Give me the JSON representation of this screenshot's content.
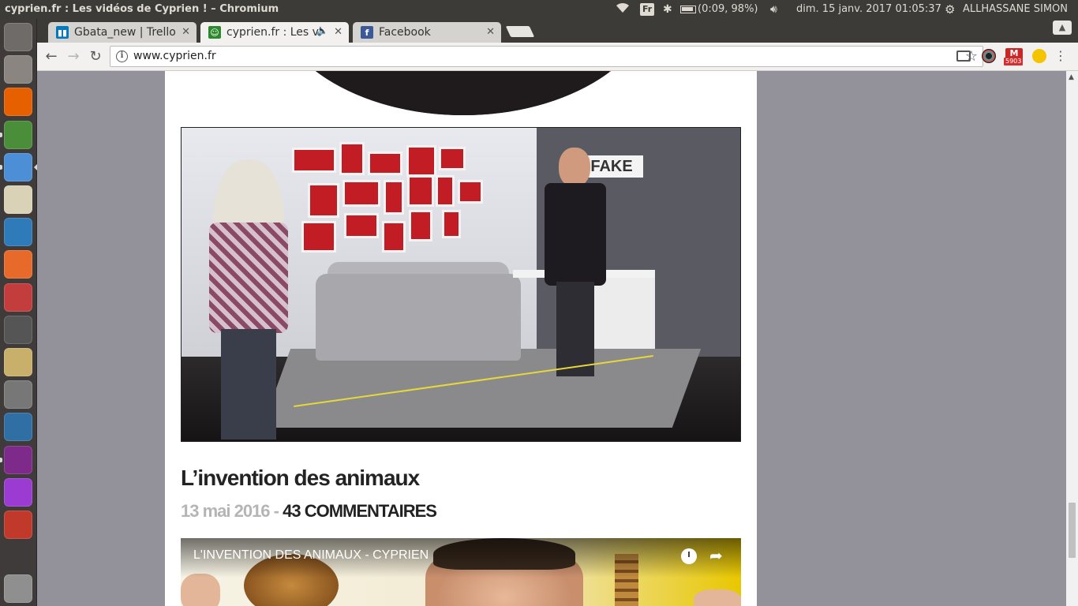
{
  "top_panel": {
    "window_title": "cyprien.fr : Les vidéos de Cyprien ! – Chromium",
    "keyboard_layout": "Fr",
    "battery": "(0:09, 98%)",
    "datetime": "dim. 15 janv. 2017 01:05:37",
    "user": "ALLHASSANE SIMON"
  },
  "launcher": {
    "items": [
      {
        "name": "ubuntu-dash-icon",
        "color": "#6f6b69"
      },
      {
        "name": "files-icon",
        "color": "#8a8580"
      },
      {
        "name": "firefox-icon",
        "color": "#e66000"
      },
      {
        "name": "chrome-icon",
        "color": "#4a8e3a"
      },
      {
        "name": "chromium-icon",
        "color": "#4d8fd6"
      },
      {
        "name": "image-viewer-icon",
        "color": "#d9d2b7"
      },
      {
        "name": "libreoffice-writer-icon",
        "color": "#2f7ab8"
      },
      {
        "name": "software-center-icon",
        "color": "#e86a2b"
      },
      {
        "name": "system-settings-icon",
        "color": "#c43d3d"
      },
      {
        "name": "color-picker-icon",
        "color": "#555555"
      },
      {
        "name": "rhythmbox-icon",
        "color": "#c9b06a"
      },
      {
        "name": "camera-icon",
        "color": "#777777"
      },
      {
        "name": "mysql-workbench-icon",
        "color": "#2f6fa4"
      },
      {
        "name": "terminal-icon",
        "color": "#7e2a8a"
      },
      {
        "name": "phpstorm-icon",
        "color": "#9b3bd1"
      },
      {
        "name": "installer-icon",
        "color": "#c0392b"
      },
      {
        "name": "trash-icon",
        "color": "#8f8f8f"
      }
    ]
  },
  "tabs": [
    {
      "title": "Gbata_new | Trello",
      "favicon": "trello-icon",
      "color": "#0079bf",
      "active": false
    },
    {
      "title": "cyprien.fr : Les vi",
      "favicon": "cyprien-icon",
      "color": "#2c8a2c",
      "active": true,
      "audio": "🔈"
    },
    {
      "title": "Facebook",
      "favicon": "facebook-icon",
      "color": "#3b5998",
      "active": false
    }
  ],
  "tab_close_glyph": "✕",
  "toolbar": {
    "back": "←",
    "forward": "→",
    "reload": "↻",
    "url": "www.cyprien.fr",
    "info_glyph": "i",
    "star_glyph": "☆",
    "gmail_count": "5903",
    "menu_glyph": "⋮"
  },
  "page": {
    "thumb_sign": "FAKE",
    "article": {
      "title": "L’invention des animaux",
      "date": "13 mai 2016",
      "separator": " - ",
      "comments": "43 COMMENTAIRES"
    },
    "video": {
      "title": "L'INVENTION DES ANIMAUX - CYPRIEN",
      "share_glyph": "➦"
    }
  },
  "scrollbar": {
    "up_glyph": "▲"
  }
}
